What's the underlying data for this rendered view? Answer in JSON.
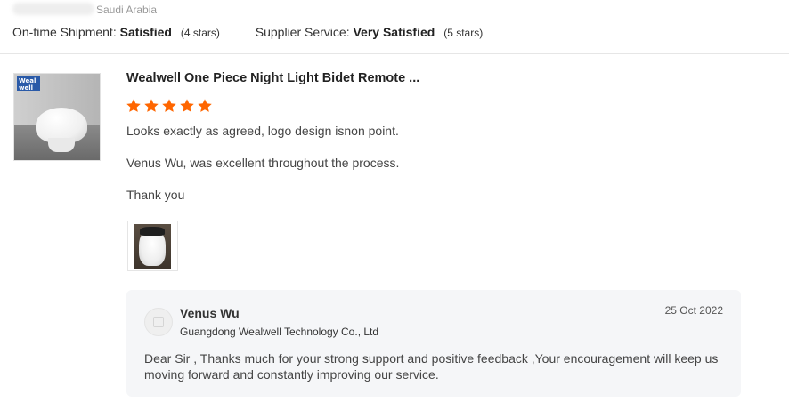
{
  "reviewer": {
    "country": "Saudi Arabia"
  },
  "ratings": {
    "shipment_label": "On-time Shipment:",
    "shipment_value": "Satisfied",
    "shipment_stars": "(4 stars)",
    "service_label": "Supplier Service:",
    "service_value": "Very Satisfied",
    "service_stars": "(5 stars)"
  },
  "product": {
    "title": "Wealwell One Piece Night Light Bidet Remote ...",
    "logo_text": "Weal well",
    "stars": 5,
    "star_color": "#ff6600"
  },
  "review": {
    "lines": [
      "Looks exactly as agreed, logo design isnon point.",
      "Venus Wu, was excellent throughout the process.",
      "Thank you"
    ]
  },
  "reply": {
    "name": "Venus Wu",
    "company": "Guangdong Wealwell Technology Co., Ltd",
    "date": "25 Oct 2022",
    "text": "Dear Sir , Thanks much for your strong support and positive feedback ,Your encouragement will keep us moving forward and constantly improving our service."
  }
}
